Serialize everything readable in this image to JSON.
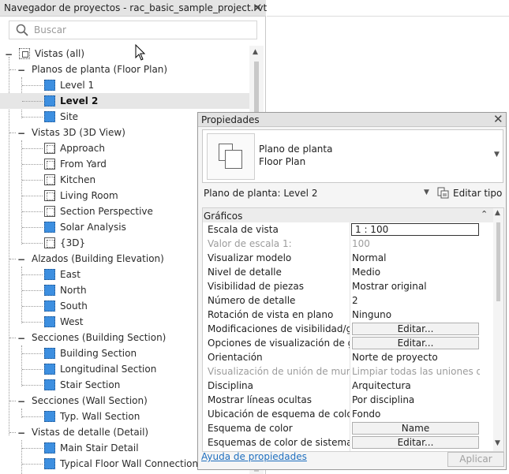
{
  "browser": {
    "title": "Navegador de proyectos - rac_basic_sample_project.rvt",
    "search_placeholder": "Buscar",
    "root": "Vistas (all)",
    "groups": [
      {
        "label": "Planos de planta (Floor Plan)",
        "items": [
          "Level 1",
          "Level 2",
          "Site"
        ]
      },
      {
        "label": "Vistas 3D (3D View)",
        "items": [
          "Approach",
          "From Yard",
          "Kitchen",
          "Living Room",
          "Section Perspective",
          "Solar Analysis",
          "{3D}"
        ]
      },
      {
        "label": "Alzados (Building Elevation)",
        "items": [
          "East",
          "North",
          "South",
          "West"
        ]
      },
      {
        "label": "Secciones (Building Section)",
        "items": [
          "Building Section",
          "Longitudinal Section",
          "Stair Section"
        ]
      },
      {
        "label": "Secciones (Wall Section)",
        "items": [
          "Typ. Wall Section"
        ]
      },
      {
        "label": "Vistas de detalle (Detail)",
        "items": [
          "Main Stair Detail",
          "Typical Floor Wall Connection"
        ]
      }
    ],
    "selected": "Level 2"
  },
  "properties": {
    "title": "Propiedades",
    "type_line1": "Plano de planta",
    "type_line2": "Floor Plan",
    "instance_selector": "Plano de planta: Level 2",
    "edit_type": "Editar tipo",
    "group": "Gráficos",
    "rows": [
      {
        "name": "Escala de vista",
        "value": "1 : 100"
      },
      {
        "name": "Valor de escala    1:",
        "value": "100"
      },
      {
        "name": "Visualizar modelo",
        "value": "Normal"
      },
      {
        "name": "Nivel de detalle",
        "value": "Medio"
      },
      {
        "name": "Visibilidad de piezas",
        "value": "Mostrar original"
      },
      {
        "name": "Número de detalle",
        "value": "2"
      },
      {
        "name": "Rotación de vista en plano",
        "value": "Ninguno"
      },
      {
        "name": "Modificaciones de visibilidad/gr...",
        "value": "Editar..."
      },
      {
        "name": "Opciones de visualización de gr...",
        "value": "Editar..."
      },
      {
        "name": "Orientación",
        "value": "Norte de proyecto"
      },
      {
        "name": "Visualización de unión de muros",
        "value": "Limpiar todas las uniones de..."
      },
      {
        "name": "Disciplina",
        "value": "Arquitectura"
      },
      {
        "name": "Mostrar líneas ocultas",
        "value": "Por disciplina"
      },
      {
        "name": "Ubicación de esquema de color",
        "value": "Fondo"
      },
      {
        "name": "Esquema de color",
        "value": "Name"
      },
      {
        "name": "Esquemas de color de sistema",
        "value": "Editar..."
      }
    ],
    "help_link": "Ayuda de propiedades",
    "apply": "Aplicar"
  }
}
